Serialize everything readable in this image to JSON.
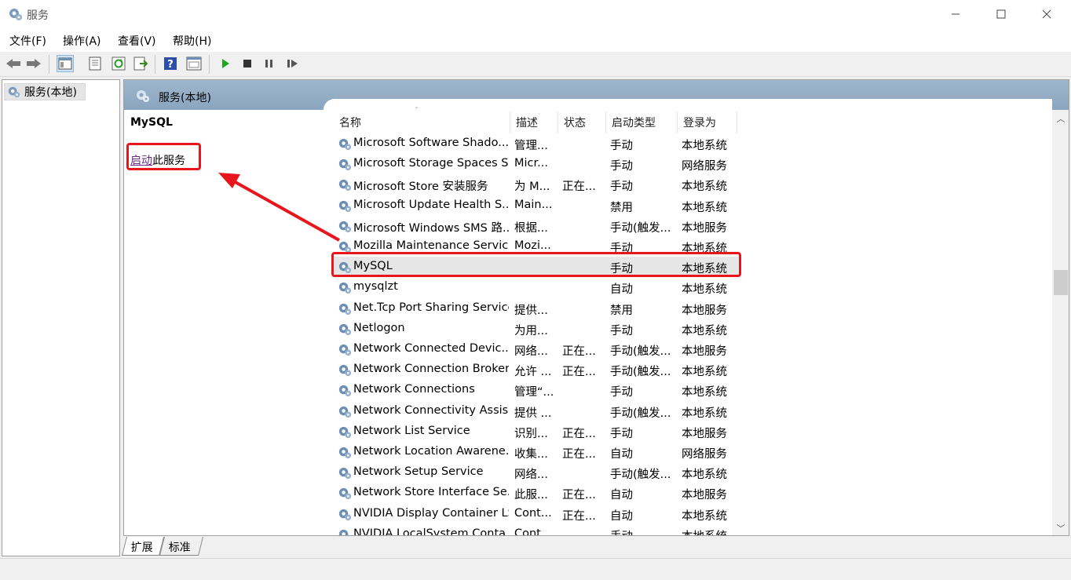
{
  "window": {
    "title": "服务"
  },
  "menu": {
    "items": [
      "文件(F)",
      "操作(A)",
      "查看(V)",
      "帮助(H)"
    ]
  },
  "tree": {
    "root_label": "服务(本地)"
  },
  "pane": {
    "header_title": "服务(本地)"
  },
  "detail": {
    "service_name": "MySQL",
    "action_link": "启动",
    "action_suffix": "此服务"
  },
  "columns": {
    "name": "名称",
    "desc": "描述",
    "status": "状态",
    "startup": "启动类型",
    "logon": "登录为"
  },
  "services": [
    {
      "name": "Microsoft Software Shado...",
      "desc": "管理...",
      "status": "",
      "startup": "手动",
      "logon": "本地系统"
    },
    {
      "name": "Microsoft Storage Spaces S...",
      "desc": "Micr...",
      "status": "",
      "startup": "手动",
      "logon": "网络服务"
    },
    {
      "name": "Microsoft Store 安装服务",
      "desc": "为 M...",
      "status": "正在...",
      "startup": "手动",
      "logon": "本地系统"
    },
    {
      "name": "Microsoft Update Health S...",
      "desc": "Main...",
      "status": "",
      "startup": "禁用",
      "logon": "本地系统"
    },
    {
      "name": "Microsoft Windows SMS 路...",
      "desc": "根据...",
      "status": "",
      "startup": "手动(触发...",
      "logon": "本地服务"
    },
    {
      "name": "Mozilla Maintenance Service",
      "desc": "Mozi...",
      "status": "",
      "startup": "手动",
      "logon": "本地系统"
    },
    {
      "name": "MySQL",
      "desc": "",
      "status": "",
      "startup": "手动",
      "logon": "本地系统"
    },
    {
      "name": "mysqlzt",
      "desc": "",
      "status": "",
      "startup": "自动",
      "logon": "本地系统"
    },
    {
      "name": "Net.Tcp Port Sharing Service",
      "desc": "提供...",
      "status": "",
      "startup": "禁用",
      "logon": "本地服务"
    },
    {
      "name": "Netlogon",
      "desc": "为用...",
      "status": "",
      "startup": "手动",
      "logon": "本地系统"
    },
    {
      "name": "Network Connected Devic...",
      "desc": "网络...",
      "status": "正在...",
      "startup": "手动(触发...",
      "logon": "本地服务"
    },
    {
      "name": "Network Connection Broker",
      "desc": "允许 ...",
      "status": "正在...",
      "startup": "手动(触发...",
      "logon": "本地系统"
    },
    {
      "name": "Network Connections",
      "desc": "管理“...",
      "status": "",
      "startup": "手动",
      "logon": "本地系统"
    },
    {
      "name": "Network Connectivity Assis...",
      "desc": "提供 ...",
      "status": "",
      "startup": "手动(触发...",
      "logon": "本地系统"
    },
    {
      "name": "Network List Service",
      "desc": "识别...",
      "status": "正在...",
      "startup": "手动",
      "logon": "本地服务"
    },
    {
      "name": "Network Location Awarene...",
      "desc": "收集...",
      "status": "正在...",
      "startup": "自动",
      "logon": "网络服务"
    },
    {
      "name": "Network Setup Service",
      "desc": "网络...",
      "status": "",
      "startup": "手动(触发...",
      "logon": "本地系统"
    },
    {
      "name": "Network Store Interface Se...",
      "desc": "此服...",
      "status": "正在...",
      "startup": "自动",
      "logon": "本地服务"
    },
    {
      "name": "NVIDIA Display Container LS",
      "desc": "Cont...",
      "status": "正在...",
      "startup": "自动",
      "logon": "本地系统"
    },
    {
      "name": "NVIDIA LocalSystem Conta...",
      "desc": "Cont...",
      "status": "",
      "startup": "手动",
      "logon": "本地系统"
    }
  ],
  "selected_service": "MySQL",
  "tabs": [
    "扩展",
    "标准"
  ],
  "toolbar": {
    "icons": [
      "back-icon",
      "forward-icon",
      "console-tree-icon",
      "properties-icon",
      "refresh-icon",
      "export-icon",
      "help-icon",
      "view-icon",
      "start-icon",
      "stop-icon",
      "pause-icon",
      "restart-icon"
    ]
  },
  "colors": {
    "header_blue": "#8aa5bf",
    "highlight_red": "#e8161c",
    "link_purple": "#6b2a8a",
    "play_green": "#1ea51e"
  }
}
